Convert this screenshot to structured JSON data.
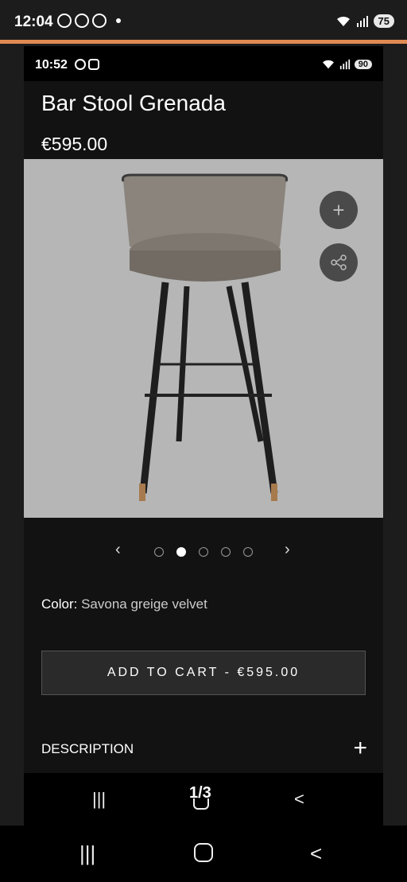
{
  "outer_status": {
    "time": "12:04",
    "battery": "75"
  },
  "inner_status": {
    "time": "10:52",
    "battery": "90"
  },
  "product": {
    "title": "Bar Stool Grenada",
    "price": "€595.00",
    "color_label": "Color:",
    "color_value": "Savona greige velvet",
    "add_to_cart": "ADD TO CART - €595.00",
    "description_label": "DESCRIPTION"
  },
  "carousel": {
    "prev": "‹",
    "next": "›",
    "active_index": 1,
    "count": 5
  },
  "viewer": {
    "page_indicator": "1/3"
  }
}
